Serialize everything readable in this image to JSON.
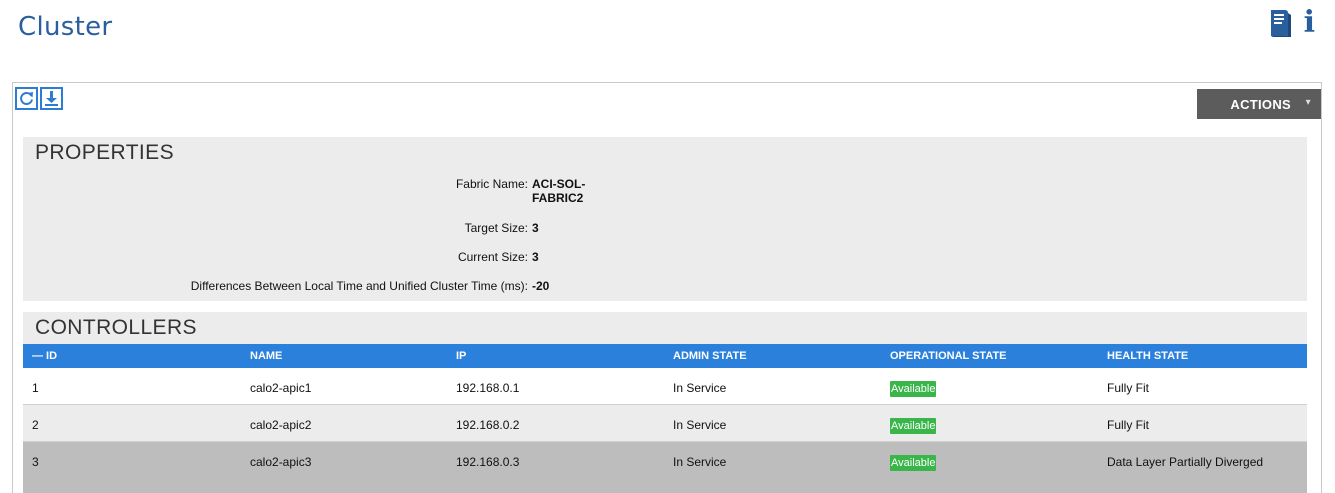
{
  "page": {
    "title": "Cluster"
  },
  "header_icons": [
    {
      "name": "book-icon"
    },
    {
      "name": "info-icon",
      "glyph": "i"
    }
  ],
  "toolbar": {
    "refresh_icon": "refresh-icon",
    "download_icon": "download-icon",
    "actions_label": "ACTIONS"
  },
  "properties": {
    "title": "PROPERTIES",
    "fabric_name_label": "Fabric Name:",
    "fabric_name_value": "ACI-SOL-\nFABRIC2",
    "target_size_label": "Target Size:",
    "target_size_value": "3",
    "current_size_label": "Current Size:",
    "current_size_value": "3",
    "time_diff_label": "Differences Between Local Time and Unified Cluster Time (ms):",
    "time_diff_value": "-20"
  },
  "controllers": {
    "title": "CONTROLLERS",
    "columns": [
      "— ID",
      "NAME",
      "IP",
      "ADMIN STATE",
      "OPERATIONAL STATE",
      "HEALTH STATE"
    ],
    "rows": [
      {
        "id": "1",
        "name": "calo2-apic1",
        "ip": "192.168.0.1",
        "admin_state": "In Service",
        "operational_state": "Available",
        "health_state": "Fully Fit"
      },
      {
        "id": "2",
        "name": "calo2-apic2",
        "ip": "192.168.0.2",
        "admin_state": "In Service",
        "operational_state": "Available",
        "health_state": "Fully Fit"
      },
      {
        "id": "3",
        "name": "calo2-apic3",
        "ip": "192.168.0.3",
        "admin_state": "In Service",
        "operational_state": "Available",
        "health_state": "Data Layer Partially Diverged"
      }
    ]
  },
  "colors": {
    "title_blue": "#2a5f9e",
    "header_blue": "#2b80dc",
    "available_green": "#39b54a",
    "actions_gray": "#5c5c5c"
  }
}
